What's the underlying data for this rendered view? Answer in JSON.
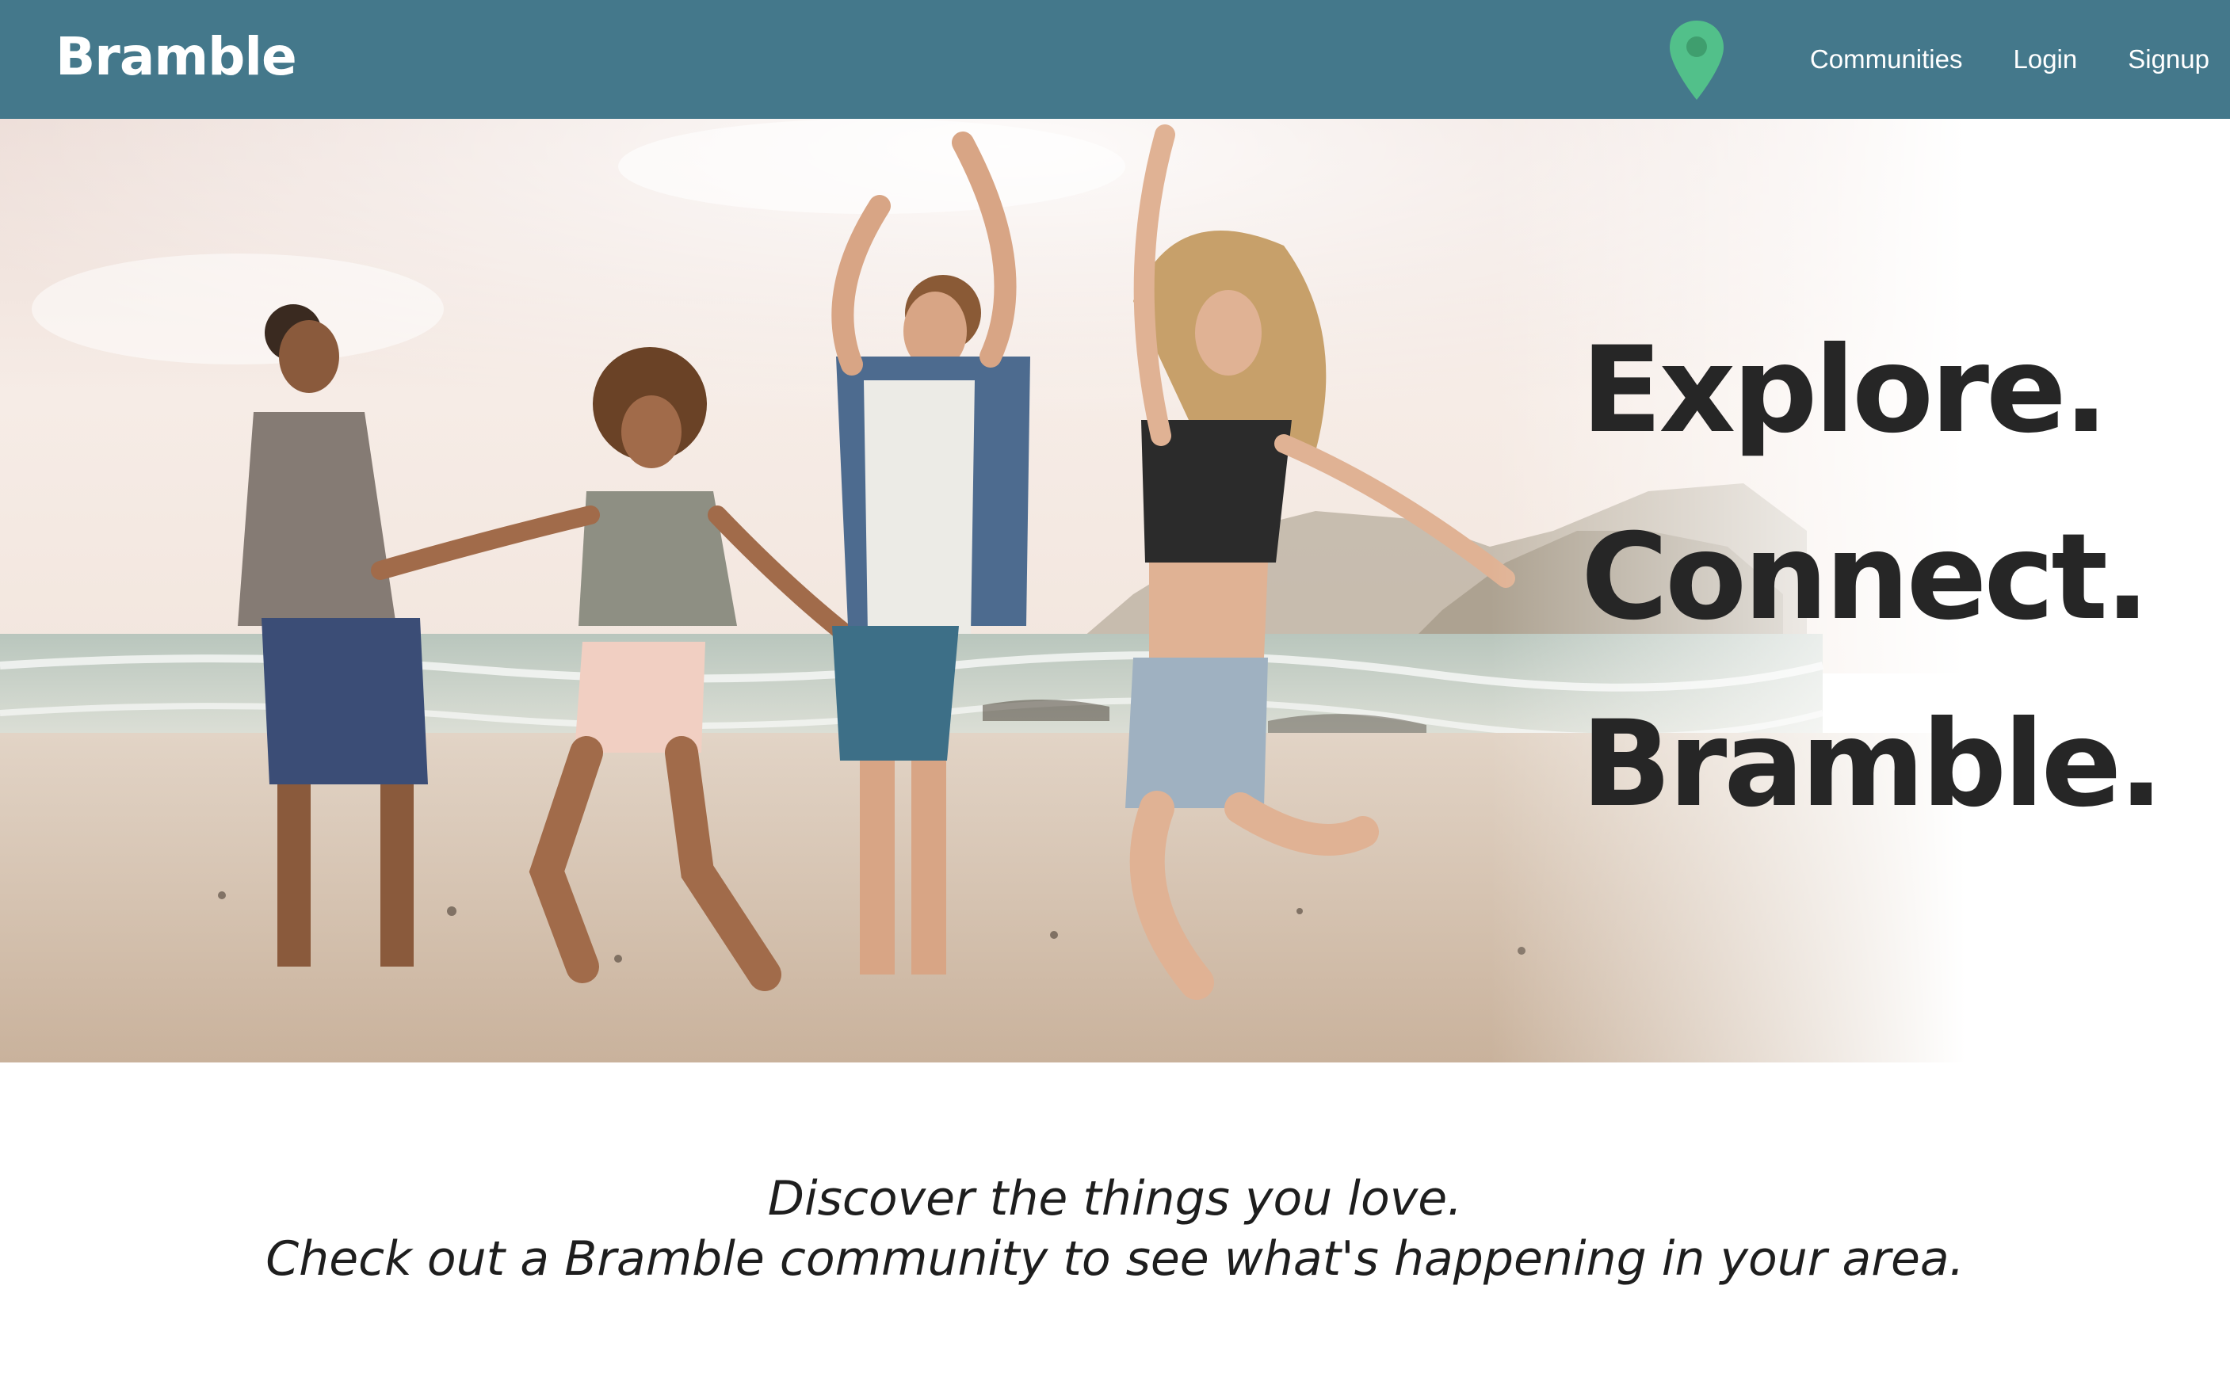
{
  "navbar": {
    "brand": "Bramble",
    "location_icon": "map-pin-icon",
    "links": [
      {
        "label": "Communities"
      },
      {
        "label": "Login"
      },
      {
        "label": "Signup"
      }
    ],
    "colors": {
      "background": "#44788b",
      "pin": "#52c08a"
    }
  },
  "hero": {
    "image": "people-dancing-on-beach-photo",
    "tagline": [
      "Explore.",
      "Connect.",
      "Bramble."
    ]
  },
  "intro": {
    "line1": "Discover the things you love.",
    "line2": "Check out a Bramble community to see what's happening in your area."
  }
}
